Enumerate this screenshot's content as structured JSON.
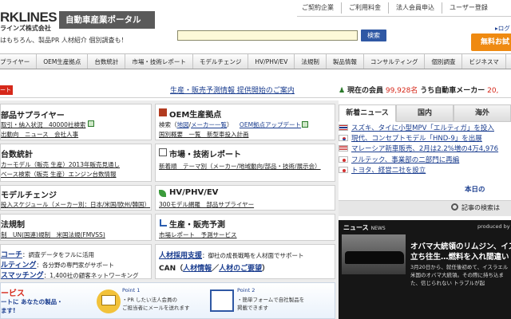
{
  "header": {
    "logo_text": "RKLINES",
    "logo_sub": "ラインズ株式会社",
    "portal_badge": "自動車産業ポータル",
    "tagline": "はもちろん、製品PR 人材紹介 個別調査も！",
    "search_placeholder": "",
    "search_button": "検索",
    "login_link": "ログ",
    "free_trial_label": "無料お試",
    "top_links": [
      "ご契約企業",
      "ご利用料金",
      "法人会員申込",
      "ユーザー登録"
    ]
  },
  "nav": {
    "items": [
      "プライヤー",
      "OEM生産拠点",
      "台数統計",
      "市場・技術レポート",
      "モデルチェンジ",
      "HV/PHV/EV",
      "法規制",
      "製品情報",
      "コンサルティング",
      "個別調査",
      "ビジネスマ"
    ]
  },
  "status_row": {
    "red_tab_text": "ート",
    "announcement": "生産・販売予測情報 提供開始のご案内",
    "current_members_label": "現在の会員",
    "current_members_value": "99,928名",
    "auto_maker_label": "うち自動車メーカー",
    "auto_maker_value": "20,"
  },
  "panels": {
    "suppliers": {
      "title": "部品サプライヤー",
      "line1": "取引・納入状況　40000社検索",
      "line2": "出動向　ニュース　会社人事"
    },
    "oem": {
      "title": "OEM生産拠点",
      "line1_prefix": "検索（",
      "line1_map": "地図",
      "line1_sep": "/",
      "line1_maker": "メーカー一覧",
      "line1_suffix": "）",
      "line1_update": "OEM拠点アップデート",
      "line2": "国別概要　一覧　新型車投入計画"
    },
    "stats": {
      "title": "台数統計",
      "line1": "カーモデル（販売 生産）2013年販売見通し",
      "line2": "ベース検索（販売 生産）エンジン台数情報"
    },
    "market": {
      "title": "市場・技術レポート",
      "line1": "新着順　テーマ別（メーカー/地域動向/部品・技術/展示会）"
    },
    "model_change": {
      "title": "モデルチェンジ",
      "line1": "投入スケジュール（メーカー別：日本/米国/欧州/韓国）"
    },
    "hv": {
      "title": "HV/PHV/EV",
      "line1": "300モデル網羅　部品サプライヤー"
    },
    "regulation": {
      "title": "法規制",
      "line1": "制　UN(国連)規制　米国法規(FMVSS)"
    },
    "forecast": {
      "title": "生産・販売予測",
      "line1": "市場レポート　予測サービス"
    },
    "consulting": {
      "line1_label": "コーチ",
      "line1_text": "：調査データをフルに活用",
      "line2_label": "ルティング",
      "line2_text": "：各分野の専門家がサポート",
      "line3_label": "スマッチング",
      "line3_text": "：1,400社の顧客ネットワーキング"
    },
    "recruit": {
      "title": "人材採用支援",
      "desc": "：御社の成長戦略を人材面でサポート",
      "can_prefix": "CAN（",
      "can_link1": "人材情報",
      "can_sep": "／",
      "can_link2": "人材のご要望",
      "can_suffix": "）"
    },
    "service_ad": {
      "title": "ービス",
      "line1": "ートに あなたの製品・",
      "line2": "ます!",
      "point1_label": "Point 1",
      "point1_text1": "・PR したい法人会員の",
      "point1_text2": "ご担当者にメールを送れます",
      "point2_label": "Point 2",
      "point2_text1": "・簡単フォームで自社製品を",
      "point2_text2": "掲載できます"
    }
  },
  "news_tabs": [
    "新着ニュース",
    "国内",
    "海外"
  ],
  "news_items": [
    {
      "flag": "th",
      "text": "スズキ、タイに小型MPV「エルティガ」を投入"
    },
    {
      "flag": "kr",
      "text": "現代、コンセプトモデル「HND-9」を出展"
    },
    {
      "flag": "my",
      "text": "マレーシア新車販売、2月は2.2%増の4万4,976"
    },
    {
      "flag": "jp",
      "text": "フルテック、事業部の二部門に再編"
    },
    {
      "flag": "jp",
      "text": "トヨタ、経営二社を設立"
    }
  ],
  "more_link": "本日の",
  "article_search": "記事の検索は",
  "news_black": {
    "header": "ニュース",
    "header_small": "NEWS",
    "produced_by": "produced by",
    "headline_line1": "オバマ大統領のリムジン、イス",
    "headline_line2": "立ち往生…燃料を入れ間違い",
    "body_line1": "3月20日から、就任後初めて、イスラエル",
    "body_line2": "米国のオバマ大統領。その際に持ち込ま",
    "body_line3": "た、信じられない トラブルが起"
  },
  "colors": {
    "nav_bg": "#e8e8e8",
    "link": "#1a3d8f",
    "accent_red": "#d6281a",
    "accent_orange": "#ef8a11",
    "search_btn": "#2f58a4"
  }
}
